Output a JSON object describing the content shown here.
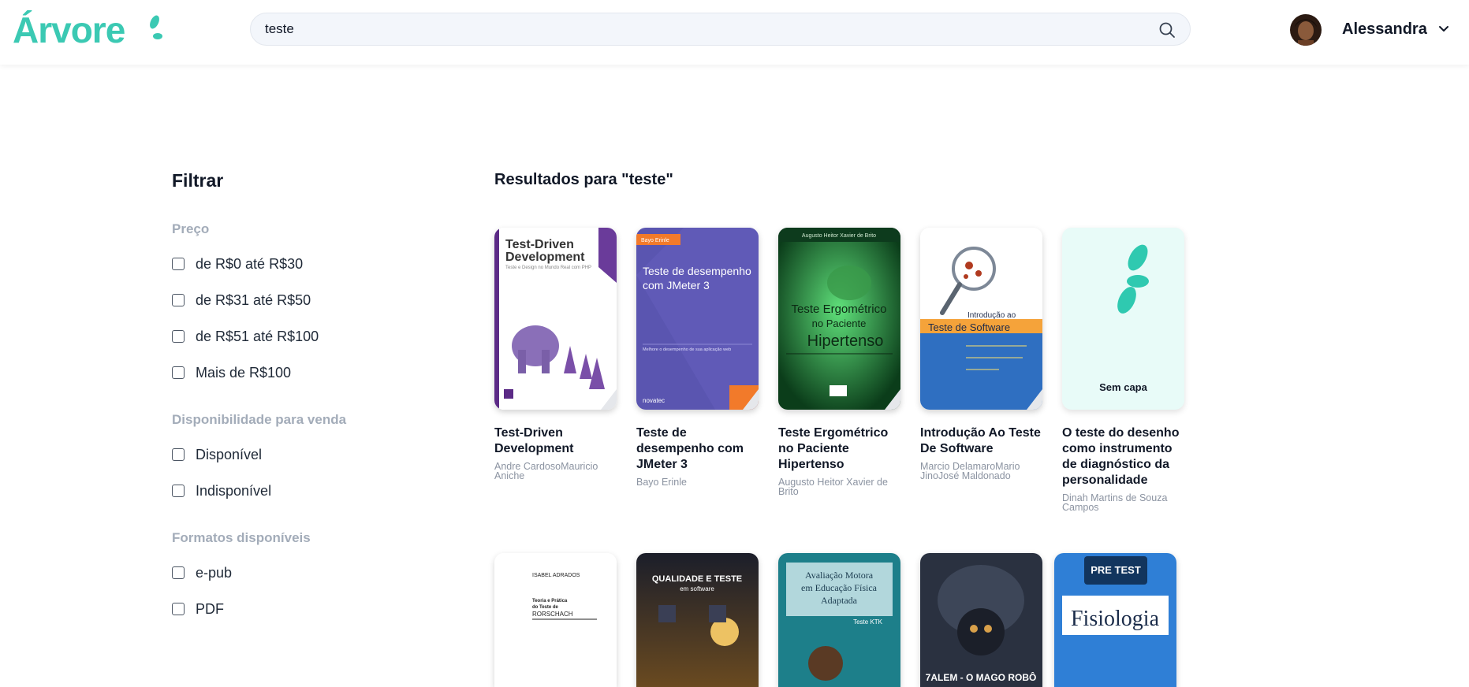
{
  "header": {
    "logo_text": "Árvore",
    "search_value": "teste",
    "user_name": "Alessandra",
    "brand_color": "#3bc9b3"
  },
  "sidebar": {
    "title": "Filtrar",
    "groups": [
      {
        "title": "Preço",
        "options": [
          "de R$0 até R$30",
          "de R$31 até R$50",
          "de R$51 até R$100",
          "Mais de R$100"
        ]
      },
      {
        "title": "Disponibilidade para venda",
        "options": [
          "Disponível",
          "Indisponível"
        ]
      },
      {
        "title": "Formatos disponíveis",
        "options": [
          "e-pub",
          "PDF"
        ]
      }
    ]
  },
  "results": {
    "title": "Resultados para \"teste\"",
    "books": [
      {
        "title": "Test-Driven Development",
        "author": "Andre CardosoMauricio Aniche",
        "cover_text": "Test-Driven Development",
        "cover_sub": "Teste e Design no Mundo Real com PHP"
      },
      {
        "title": "Teste de desempenho com JMeter 3",
        "author": "Bayo Erinle",
        "cover_text": "Teste de desempenho com JMeter 3",
        "cover_badge": "Bayo Erinle",
        "cover_sub": "Melhore o desempenho de sua aplicação web",
        "cover_publisher": "novatec"
      },
      {
        "title": "Teste Ergométrico no Paciente Hipertenso",
        "author": "Augusto Heitor Xavier de Brito",
        "cover_text": "Teste Ergométrico no Paciente Hipertenso",
        "cover_top": "Augusto Heitor Xavier de Brito"
      },
      {
        "title": "Introdução Ao Teste De Software",
        "author": "Marcio DelamaroMario JinoJosé Maldonado",
        "cover_text1": "Introdução ao",
        "cover_text2": "Teste de Software"
      },
      {
        "title": "O teste do desenho como instrumento de diagnóstico da personalidade",
        "author": "Dinah Martins de Souza Campos",
        "cover_text": "Sem capa"
      }
    ],
    "row2_covers": [
      {
        "line1": "ISABEL ADRADOS",
        "line2": "Teoria e Prática do Teste de RORSCHACH"
      },
      {
        "line1": "QUALIDADE E TESTE",
        "line2": "em software"
      },
      {
        "line1": "Avaliação Motora em Educação Física Adaptada",
        "line2": "Teste KTK"
      },
      {
        "line1": "7ALEM - O MAGO ROBÔ"
      },
      {
        "line1": "PRE TEST",
        "line2": "Fisiologia"
      }
    ]
  }
}
